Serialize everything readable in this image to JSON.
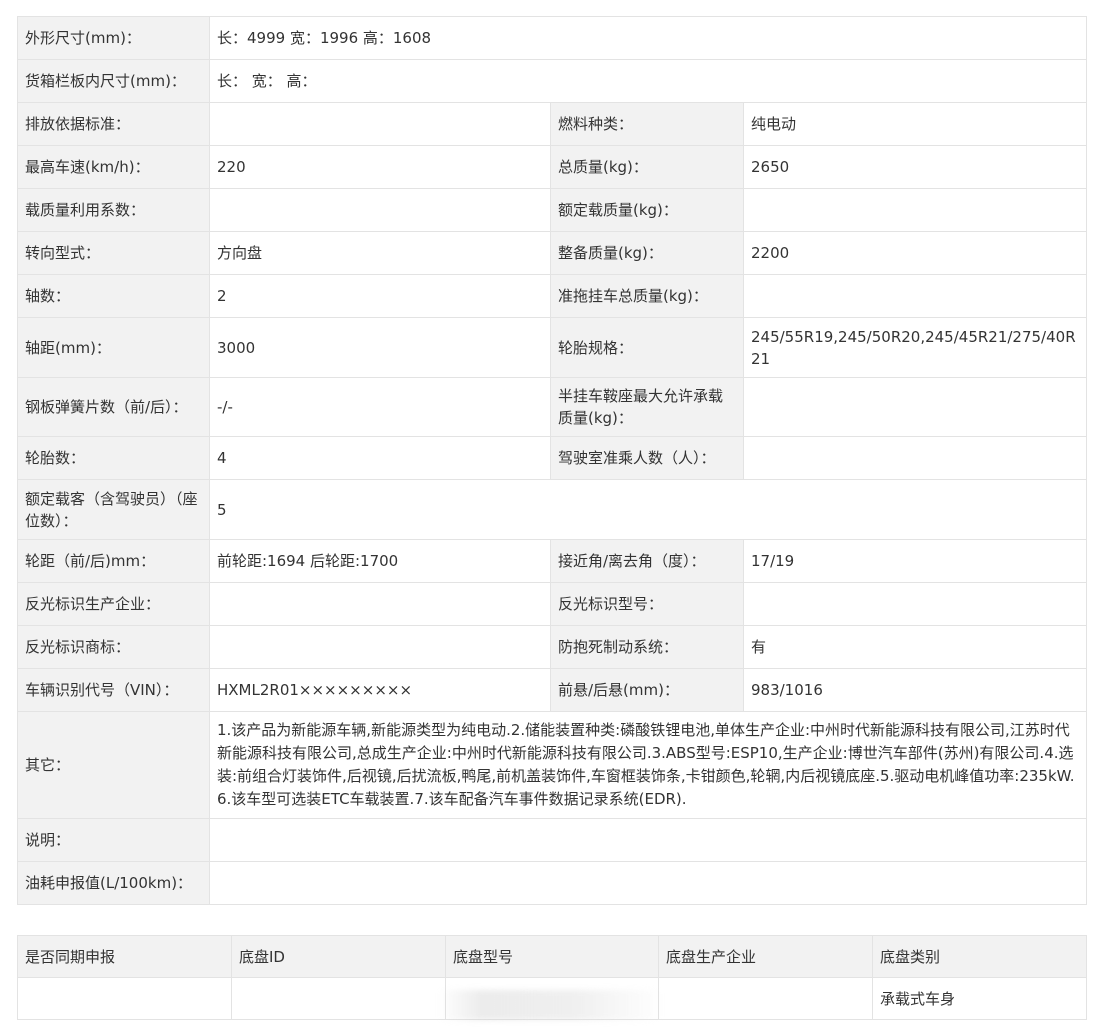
{
  "spec": {
    "dimensions_label": "外形尺寸(mm)：",
    "dimensions_value": "长：4999 宽：1996 高：1608",
    "cargo_box_label": "货箱栏板内尺寸(mm)：",
    "cargo_box_value": "长：  宽：  高：",
    "emission_label": "排放依据标准：",
    "emission_value": "",
    "fuel_label": "燃料种类：",
    "fuel_value": "纯电动",
    "max_speed_label": "最高车速(km/h)：",
    "max_speed_value": "220",
    "total_mass_label": "总质量(kg)：",
    "total_mass_value": "2650",
    "load_util_label": "载质量利用系数：",
    "load_util_value": "",
    "rated_load_label": "额定载质量(kg)：",
    "rated_load_value": "",
    "steering_label": "转向型式：",
    "steering_value": "方向盘",
    "curb_mass_label": "整备质量(kg)：",
    "curb_mass_value": "2200",
    "axles_label": "轴数：",
    "axles_value": "2",
    "trailer_mass_label": "准拖挂车总质量(kg)：",
    "trailer_mass_value": "",
    "wheelbase_label": "轴距(mm)：",
    "wheelbase_value": "3000",
    "tire_spec_label": "轮胎规格：",
    "tire_spec_value": "245/55R19,245/50R20,245/45R21/275/40R21",
    "leaf_spring_label": "钢板弹簧片数（前/后）：",
    "leaf_spring_value": "-/-",
    "saddle_load_label": "半挂车鞍座最大允许承载质量(kg)：",
    "saddle_load_value": "",
    "tire_count_label": "轮胎数：",
    "tire_count_value": "4",
    "cab_seats_label": "驾驶室准乘人数（人）：",
    "cab_seats_value": "",
    "passengers_label": "额定载客（含驾驶员）（座位数）：",
    "passengers_value": "5",
    "track_label": "轮距（前/后)mm：",
    "track_value": "前轮距:1694 后轮距:1700",
    "angle_label": "接近角/离去角（度）：",
    "angle_value": "17/19",
    "reflector_maker_label": "反光标识生产企业：",
    "reflector_maker_value": "",
    "reflector_model_label": "反光标识型号：",
    "reflector_model_value": "",
    "reflector_brand_label": "反光标识商标：",
    "reflector_brand_value": "",
    "abs_label": "防抱死制动系统：",
    "abs_value": "有",
    "vin_label": "车辆识别代号（VIN）：",
    "vin_value": "HXML2R01×××××××××",
    "overhang_label": "前悬/后悬(mm)：",
    "overhang_value": "983/1016",
    "other_label": "其它：",
    "other_value": "1.该产品为新能源车辆,新能源类型为纯电动.2.储能装置种类:磷酸铁锂电池,单体生产企业:中州时代新能源科技有限公司,江苏时代新能源科技有限公司,总成生产企业:中州时代新能源科技有限公司.3.ABS型号:ESP10,生产企业:博世汽车部件(苏州)有限公司.4.选装:前组合灯装饰件,后视镜,后扰流板,鸭尾,前机盖装饰件,车窗框装饰条,卡钳颜色,轮辋,内后视镜底座.5.驱动电机峰值功率:235kW.6.该车型可选装ETC车载装置.7.该车配备汽车事件数据记录系统(EDR).",
    "note_label": "说明：",
    "note_value": "",
    "fuel_consumption_label": "油耗申报值(L/100km)：",
    "fuel_consumption_value": ""
  },
  "chassis": {
    "headers": [
      "是否同期申报",
      "底盘ID",
      "底盘型号",
      "底盘生产企业",
      "底盘类别"
    ],
    "row": [
      "",
      "",
      "",
      "",
      "承载式车身"
    ]
  },
  "colors": {
    "label_background": "#f2f2f2",
    "border": "#e3e3e3",
    "text": "#333333"
  }
}
